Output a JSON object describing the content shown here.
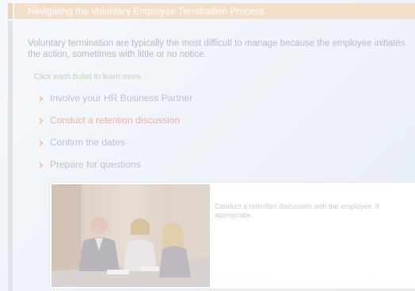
{
  "header": {
    "title": "Navigating the Voluntary Employee Termination Process"
  },
  "content": {
    "intro": "Voluntary termination are typically the most difficult to manage because the employee initiates the action, sometimes with little or no notice.",
    "instruction": "Click each bullet to learn more.",
    "bullets": [
      {
        "label": "Involve your HR Business Partner",
        "active": false
      },
      {
        "label": "Conduct a retention discussion",
        "active": true
      },
      {
        "label": "Confirm the dates",
        "active": false
      },
      {
        "label": "Prepare for questions",
        "active": false
      }
    ],
    "detail": {
      "caption": "Conduct a retention discussion with the employee, if appropriate."
    }
  },
  "colors": {
    "title_bar": "#f1dfca",
    "active_bullet": "#f0b0a4",
    "inactive_bullet": "#b9c3cf",
    "bullet_arrow": "#f1c9a6",
    "instruction_text": "#b7d9b5"
  }
}
